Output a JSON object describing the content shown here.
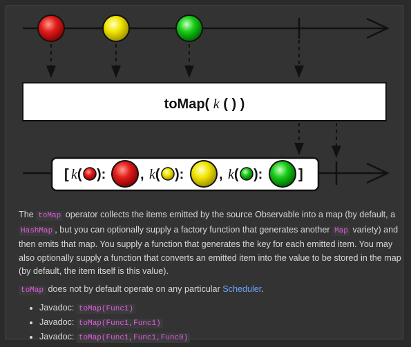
{
  "diagram": {
    "operator_label": "toMap( k( ) )",
    "operator_name": "toMap(",
    "operator_fn": "k",
    "operator_close": "( ) )",
    "result_text": {
      "open": "[",
      "k1": "k(",
      "close_paren": "):",
      "sep": ",",
      "end": "]"
    },
    "marble_colors": [
      "#e31d1d",
      "#f2e600",
      "#18cc18"
    ]
  },
  "description": {
    "p1_a": "The",
    "p1_code1": "toMap",
    "p1_b": "operator collects the items emitted by the source Observable into a map (by default, a",
    "p1_code2": "HashMap",
    "p1_c": ", but you can optionally supply a factory function that generates another",
    "p1_code3": "Map",
    "p1_d": "variety) and then emits that map. You supply a function that generates the key for each emitted item. You may also optionally supply a function that converts an emitted item into the value to be stored in the map (by default, the item itself is this value).",
    "p2_code": "toMap",
    "p2_text": "does not by default operate on any particular",
    "p2_link": "Scheduler",
    "p2_end": "."
  },
  "javadocs": [
    {
      "label": "Javadoc:",
      "code": "toMap(Func1)"
    },
    {
      "label": "Javadoc:",
      "code": "toMap(Func1,Func1)"
    },
    {
      "label": "Javadoc:",
      "code": "toMap(Func1,Func1,Func0)"
    }
  ]
}
